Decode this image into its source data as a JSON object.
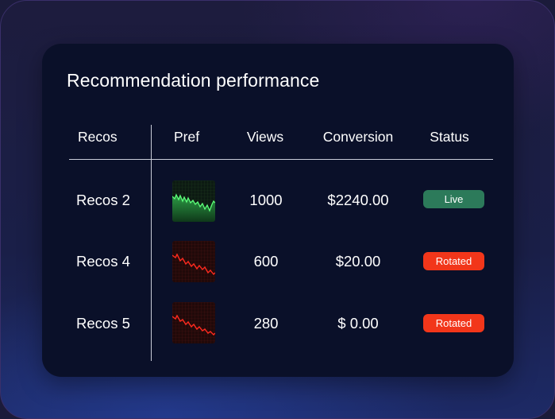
{
  "card": {
    "title": "Recommendation performance"
  },
  "table": {
    "headers": {
      "recos": "Recos",
      "pref": "Pref",
      "views": "Views",
      "conversion": "Conversion",
      "status": "Status"
    },
    "rows": [
      {
        "name": "Recos 2",
        "views": "1000",
        "conversion": "$2240.00",
        "status": "Live",
        "trend": "up",
        "trend_icon": "green-sparkline-icon"
      },
      {
        "name": "Recos 4",
        "views": "600",
        "conversion": "$20.00",
        "status": "Rotated",
        "trend": "down",
        "trend_icon": "red-sparkline-icon"
      },
      {
        "name": "Recos 5",
        "views": "280",
        "conversion": "$ 0.00",
        "status": "Rotated",
        "trend": "down",
        "trend_icon": "red-sparkline-icon"
      }
    ]
  },
  "colors": {
    "card_background": "#0a1029",
    "live_badge": "#2c7a5a",
    "rotated_badge": "#f2361a",
    "trend_up": "#3fd35a",
    "trend_down": "#ff2a1f"
  }
}
